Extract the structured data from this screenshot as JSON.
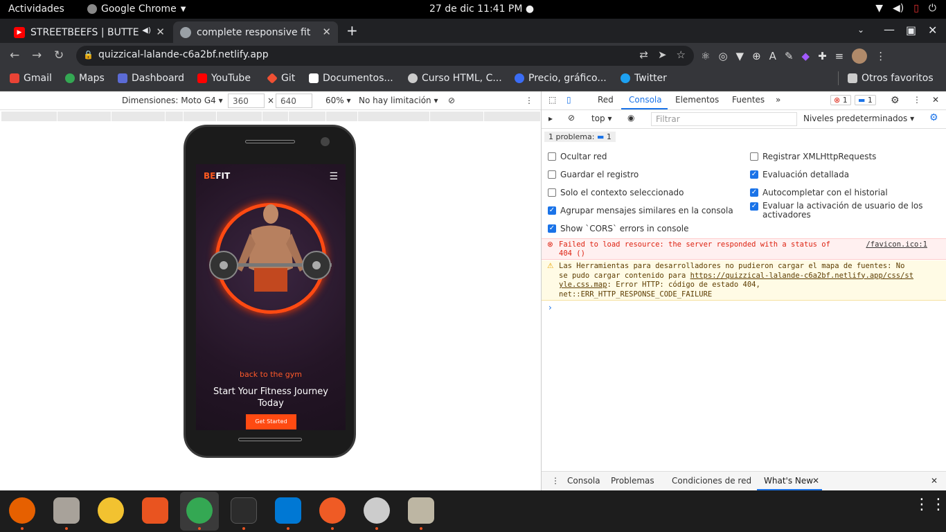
{
  "system": {
    "activities": "Actividades",
    "app_name": "Google Chrome",
    "clock": "27 de dic  11:41 PM"
  },
  "tabs": [
    {
      "title": "STREETBEEFS | BUTTE",
      "favicon": "youtube-icon",
      "active": false
    },
    {
      "title": "complete responsive fitne",
      "favicon": "globe-icon",
      "active": true
    }
  ],
  "omnibox": {
    "url": "quizzical-lalande-c6a2bf.netlify.app"
  },
  "bookmarks": [
    {
      "label": "Gmail",
      "icon": "gmail-icon",
      "color": "#ea4335"
    },
    {
      "label": "Maps",
      "icon": "maps-icon",
      "color": "#34a853"
    },
    {
      "label": "Dashboard",
      "icon": "dashboard-icon",
      "color": "#5b6bd6"
    },
    {
      "label": "YouTube",
      "icon": "youtube-icon",
      "color": "#ff0000"
    },
    {
      "label": "Git",
      "icon": "git-icon",
      "color": "#f05033"
    },
    {
      "label": "Documentos...",
      "icon": "document-icon",
      "color": "#ffffff"
    },
    {
      "label": "Curso HTML, C...",
      "icon": "globe-icon",
      "color": "#cccccc"
    },
    {
      "label": "Precio, gráfico...",
      "icon": "coin-icon",
      "color": "#3b6df5"
    },
    {
      "label": "Twitter",
      "icon": "twitter-icon",
      "color": "#1da1f2"
    },
    {
      "label": "Otros favoritos",
      "icon": "folder-icon",
      "color": "#cccccc"
    }
  ],
  "device_toolbar": {
    "dimensions": "Dimensiones: Moto G4",
    "width": "360",
    "height": "640",
    "times": "×",
    "zoom": "60%",
    "throttle": "No hay limitación"
  },
  "site": {
    "logo_be": "BE",
    "logo_fit": "FIT",
    "tagline": "back to the gym",
    "headline": "Start Your Fitness Journey Today",
    "cta": "Get Started",
    "accent": "#ff4a12"
  },
  "devtools": {
    "tabs": [
      "Red",
      "Consola",
      "Elementos",
      "Fuentes"
    ],
    "active_tab": "Consola",
    "errors": "1",
    "messages": "1",
    "context": "top",
    "filter_placeholder": "Filtrar",
    "levels": "Niveles predeterminados",
    "issues": "1 problema:",
    "issues_count": "1",
    "settings_left": [
      {
        "label": "Ocultar red",
        "checked": false
      },
      {
        "label": "Guardar el registro",
        "checked": false
      },
      {
        "label": "Solo el contexto seleccionado",
        "checked": false
      },
      {
        "label": "Agrupar mensajes similares en la consola",
        "checked": true
      },
      {
        "label": "Show `CORS` errors in console",
        "checked": true
      }
    ],
    "settings_right": [
      {
        "label": "Registrar XMLHttpRequests",
        "checked": false
      },
      {
        "label": "Evaluación detallada",
        "checked": true
      },
      {
        "label": "Autocompletar con el historial",
        "checked": true
      },
      {
        "label": "Evaluar la activación de usuario de los activadores",
        "checked": true
      }
    ],
    "error_line1": "Failed to load resource: the server responded with a status of",
    "error_line2": "404 ()",
    "error_source": "/favicon.ico:1",
    "warn_line1": "Las Herramientas para desarrolladores no pudieron cargar el mapa de fuentes: No",
    "warn_line2a": "se pudo cargar contenido para ",
    "warn_link_a": "https://quizzical-lalande-c6a2bf.netlify.app/css/st",
    "warn_link_b": "yle.css.map",
    "warn_line3b": ": Error HTTP: código de estado 404,",
    "warn_line4": "net::ERR_HTTP_RESPONSE_CODE_FAILURE",
    "prompt": "›",
    "drawer_tabs": [
      "Consola",
      "Problemas",
      "Condiciones de red",
      "What's New"
    ],
    "drawer_active": "What's New"
  },
  "dock": [
    "firefox-icon",
    "files-icon",
    "rhythmbox-icon",
    "software-icon",
    "chrome-icon",
    "terminal-icon",
    "vscode-icon",
    "postman-icon",
    "inkscape-icon",
    "archive-icon",
    "app-grid-icon"
  ]
}
